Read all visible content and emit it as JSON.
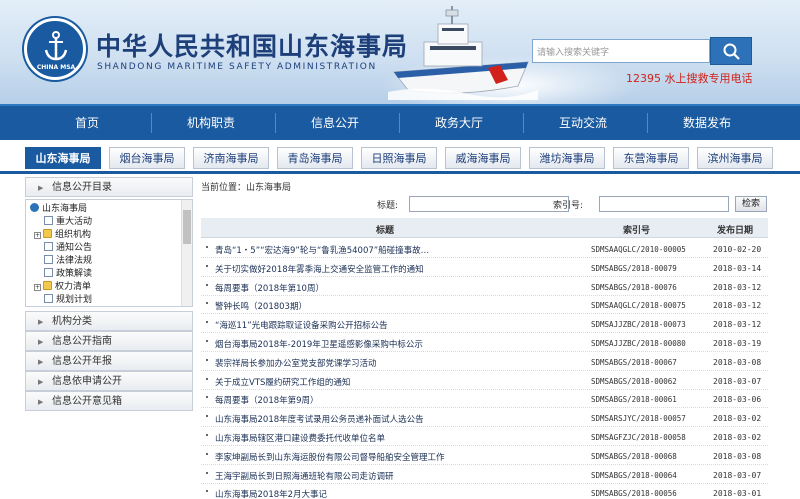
{
  "header": {
    "title": "中华人民共和国山东海事局",
    "subtitle": "SHANDONG MARITIME SAFETY ADMINISTRATION",
    "logo_text": "CHINA MSA",
    "search_placeholder": "请输入搜索关键字",
    "hotline": "12395 水上搜救专用电话"
  },
  "main_nav": [
    "首页",
    "机构职责",
    "信息公开",
    "政务大厅",
    "互动交流",
    "数据发布"
  ],
  "bureau_tabs": [
    "山东海事局",
    "烟台海事局",
    "济南海事局",
    "青岛海事局",
    "日照海事局",
    "威海海事局",
    "潍坊海事局",
    "东营海事局",
    "滨州海事局"
  ],
  "sidebar": {
    "sections": [
      "信息公开目录",
      "机构分类",
      "信息公开指南",
      "信息公开年报",
      "信息依申请公开",
      "信息公开意见箱"
    ],
    "tree": [
      {
        "label": "山东海事局",
        "level": 0,
        "icon": "root"
      },
      {
        "label": "重大活动",
        "level": 1,
        "icon": "page"
      },
      {
        "label": "组织机构",
        "level": 1,
        "icon": "folder",
        "expander": "+"
      },
      {
        "label": "通知公告",
        "level": 1,
        "icon": "page"
      },
      {
        "label": "法律法规",
        "level": 1,
        "icon": "page"
      },
      {
        "label": "政策解读",
        "level": 1,
        "icon": "page"
      },
      {
        "label": "权力清单",
        "level": 1,
        "icon": "folder",
        "expander": "+"
      },
      {
        "label": "规划计划",
        "level": 1,
        "icon": "page"
      }
    ]
  },
  "content": {
    "breadcrumb": "当前位置：山东海事局",
    "filter": {
      "title_label": "标题:",
      "index_label": "索引号:",
      "search_button": "检索"
    },
    "columns": [
      "标题",
      "索引号",
      "发布日期"
    ],
    "rows": [
      {
        "title": "青岛“1・5”“宏达海9”轮与“鲁乳渔54007”船碰撞事故…",
        "index": "SDMSAAQGLC/2010-00005",
        "date": "2010-02-20"
      },
      {
        "title": "关于切实做好2018年雾季海上交通安全监管工作的通知",
        "index": "SDMSABGS/2018-00079",
        "date": "2018-03-14"
      },
      {
        "title": "每周要事（2018年第10周）",
        "index": "SDMSABGS/2018-00076",
        "date": "2018-03-12"
      },
      {
        "title": "警钟长鸣（201803期）",
        "index": "SDMSAAQGLC/2018-00075",
        "date": "2018-03-12"
      },
      {
        "title": "“海巡11”光电跟踪取证设备采购公开招标公告",
        "index": "SDMSAJJZBC/2018-00073",
        "date": "2018-03-12"
      },
      {
        "title": "烟台海事局2018年-2019年卫星遥感影像采购中标公示",
        "index": "SDMSAJJZBC/2018-00080",
        "date": "2018-03-19"
      },
      {
        "title": "裴宗祥局长参加办公室党支部党课学习活动",
        "index": "SDMSABGS/2018-00067",
        "date": "2018-03-08"
      },
      {
        "title": "关于成立VTS履约研究工作组的通知",
        "index": "SDMSABGS/2018-00062",
        "date": "2018-03-07"
      },
      {
        "title": "每周要事（2018年第9周）",
        "index": "SDMSABGS/2018-00061",
        "date": "2018-03-06"
      },
      {
        "title": "山东海事局2018年度考试录用公务员递补面试人选公告",
        "index": "SDMSARSJYC/2018-00057",
        "date": "2018-03-02"
      },
      {
        "title": "山东海事局辖区港口建设费委托代收单位名单",
        "index": "SDMSAGFZJC/2018-00058",
        "date": "2018-03-02"
      },
      {
        "title": "李家坤副局长到山东海运股份有限公司督导船舶安全管理工作",
        "index": "SDMSABGS/2018-00068",
        "date": "2018-03-08"
      },
      {
        "title": "王海宇副局长到日照海通班轮有限公司走访调研",
        "index": "SDMSABGS/2018-00064",
        "date": "2018-03-07"
      },
      {
        "title": "山东海事局2018年2月大事记",
        "index": "SDMSABGS/2018-00056",
        "date": "2018-03-01"
      }
    ]
  }
}
